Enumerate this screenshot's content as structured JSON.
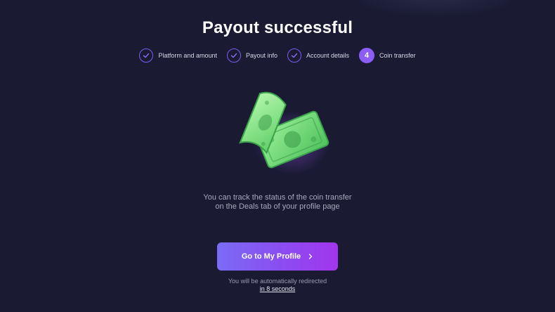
{
  "page": {
    "title": "Payout successful"
  },
  "steps": [
    {
      "label": "Platform and amount",
      "state": "done",
      "icon": "check-icon"
    },
    {
      "label": "Payout info",
      "state": "done",
      "icon": "check-icon"
    },
    {
      "label": "Account details",
      "state": "done",
      "icon": "check-icon"
    },
    {
      "label": "Coin transfer",
      "state": "active",
      "number": "4"
    }
  ],
  "illustration": {
    "icon": "money-bills-icon"
  },
  "message": {
    "line1": "You can track the status of the coin transfer",
    "line2": "on the Deals tab of your profile page"
  },
  "cta": {
    "label": "Go to My Profile",
    "icon": "chevron-right-icon"
  },
  "redirect": {
    "text": "You will be automatically redirected",
    "countdown": "in 8 seconds"
  },
  "colors": {
    "background": "#1a1a33",
    "accent": "#8b5cf6",
    "cta_start": "#7b6cf5",
    "cta_end": "#a335ee"
  }
}
